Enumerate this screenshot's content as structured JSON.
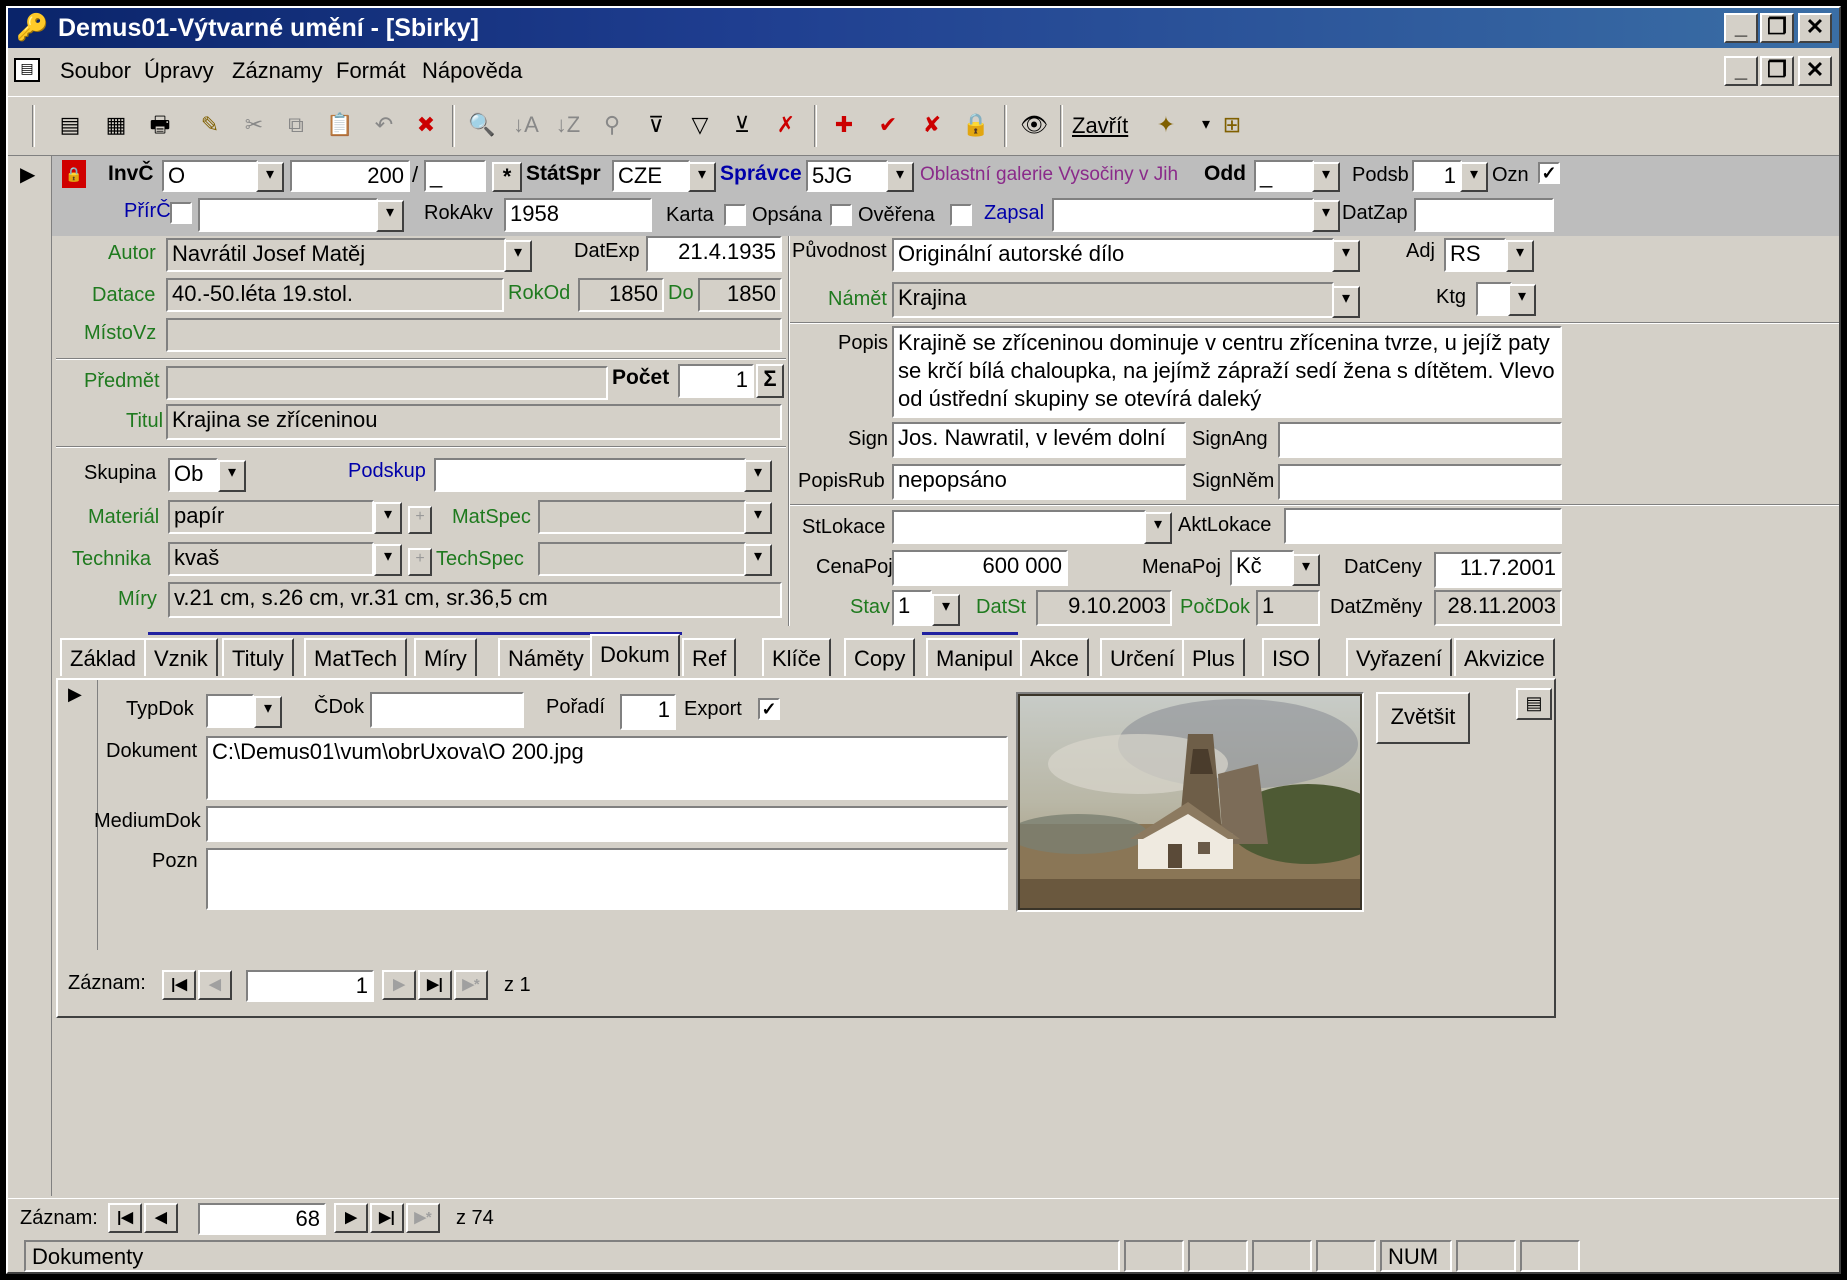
{
  "window": {
    "title": "Demus01-Výtvarné umění - [Sbirky]"
  },
  "menu": [
    "Soubor",
    "Úpravy",
    "Záznamy",
    "Formát",
    "Nápověda"
  ],
  "toolbar": {
    "close_label": "Zavřít"
  },
  "header": {
    "invc_label": "InvČ",
    "invc_prefix": "O",
    "invc_number": "200",
    "invc_slash": "/",
    "invc_suffix": "_",
    "statspr_label": "StátSpr",
    "statspr_value": "CZE",
    "spravce_label": "Správce",
    "spravce_value": "5JG",
    "spravce_name": "Oblastní galerie Vysočiny v Jih",
    "odd_label": "Odd",
    "odd_value": "_",
    "podsb_label": "Podsb",
    "podsb_value": "1",
    "ozn_label": "Ozn",
    "pric_label": "PřírČ",
    "pric_value": "",
    "rokakv_label": "RokAkv",
    "rokakv_value": "1958",
    "karta_label": "Karta",
    "opsana_label": "Opsána",
    "overena_label": "Ověřena",
    "zapsal_label": "Zapsal",
    "zapsal_value": "",
    "datzap_label": "DatZap",
    "datzap_value": ""
  },
  "left": {
    "autor_label": "Autor",
    "autor_value": "Navrátil Josef Matěj",
    "datexp_label": "DatExp",
    "datexp_value": "21.4.1935",
    "datace_label": "Datace",
    "datace_value": "40.-50.léta 19.stol.",
    "rokod_label": "RokOd",
    "rokod_value": "1850",
    "do_label": "Do",
    "do_value": "1850",
    "mistovz_label": "MístoVz",
    "mistovz_value": "",
    "predmet_label": "Předmět",
    "predmet_value": "",
    "pocet_label": "Počet",
    "pocet_value": "1",
    "sigma": "Σ",
    "titul_label": "Titul",
    "titul_value": "Krajina se zříceninou",
    "skupina_label": "Skupina",
    "skupina_value": "Ob",
    "podskup_label": "Podskup",
    "podskup_value": "",
    "material_label": "Materiál",
    "material_value": "papír",
    "matspec_label": "MatSpec",
    "matspec_value": "",
    "technika_label": "Technika",
    "technika_value": "kvaš",
    "techspec_label": "TechSpec",
    "techspec_value": "",
    "miry_label": "Míry",
    "miry_value": "v.21 cm, s.26 cm, vr.31 cm, sr.36,5 cm"
  },
  "right": {
    "puvodnost_label": "Původnost",
    "puvodnost_value": "Originální autorské dílo",
    "adj_label": "Adj",
    "adj_value": "RS",
    "namet_label": "Námět",
    "namet_value": "Krajina",
    "ktg_label": "Ktg",
    "ktg_value": "",
    "popis_label": "Popis",
    "popis_value": "Krajině se zříceninou dominuje v centru zřícenina tvrze, u jejíž paty se krčí bílá chaloupka, na jejímž zápraží sedí žena s dítětem. Vlevo od ústřední skupiny se otevírá daleký",
    "sign_label": "Sign",
    "sign_value": "Jos. Nawratil, v levém dolní",
    "signang_label": "SignAng",
    "signang_value": "",
    "popisrub_label": "PopisRub",
    "popisrub_value": "nepopsáno",
    "signnem_label": "SignNěm",
    "signnem_value": "",
    "stlokace_label": "StLokace",
    "stlokace_value": "",
    "aktlokace_label": "AktLokace",
    "aktlokace_value": "",
    "cenapoj_label": "CenaPoj",
    "cenapoj_value": "600 000",
    "menapoj_label": "MenaPoj",
    "menapoj_value": "Kč",
    "datceny_label": "DatCeny",
    "datceny_value": "11.7.2001",
    "stav_label": "Stav",
    "stav_value": "1",
    "datst_label": "DatSt",
    "datst_value": "9.10.2003",
    "pocdok_label": "PočDok",
    "pocdok_value": "1",
    "datzmeny_label": "DatZměny",
    "datzmeny_value": "28.11.2003"
  },
  "tabs": [
    "Základ",
    "Vznik",
    "Tituly",
    "MatTech",
    "Míry",
    "Náměty",
    "Dokum",
    "Ref",
    "Klíče",
    "Copy",
    "Manipul",
    "Akce",
    "Určení",
    "Plus",
    "ISO",
    "Vyřazení",
    "Akvizice"
  ],
  "active_tab": "Dokum",
  "dokum": {
    "typdok_label": "TypDok",
    "typdok_value": "",
    "cdok_label": "ČDok",
    "cdok_value": "",
    "poradi_label": "Pořadí",
    "poradi_value": "1",
    "export_label": "Export",
    "dokument_label": "Dokument",
    "dokument_value": "C:\\Demus01\\vum\\obrUxova\\O 200.jpg",
    "mediumdok_label": "MediumDok",
    "mediumdok_value": "",
    "pozn_label": "Pozn",
    "pozn_value": "",
    "zvetsit_label": "Zvětšit"
  },
  "subnav": {
    "label": "Záznam:",
    "current": "1",
    "total": "z 1"
  },
  "mainnav": {
    "label": "Záznam:",
    "current": "68",
    "total": "z 74"
  },
  "statusbar": {
    "text": "Dokumenty",
    "num": "NUM"
  }
}
